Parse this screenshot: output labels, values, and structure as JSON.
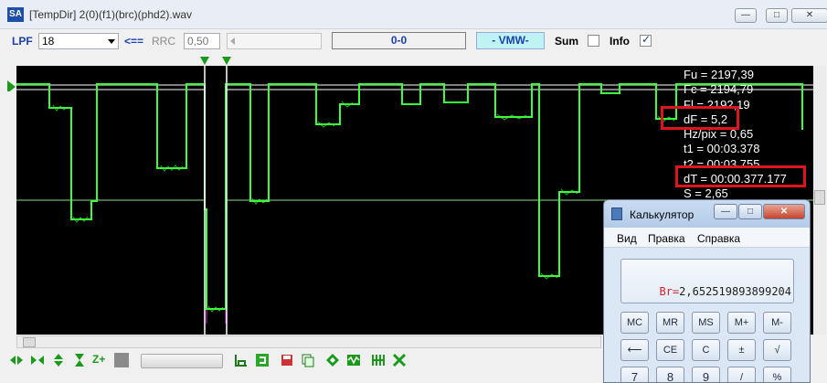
{
  "window": {
    "icon_text": "SA",
    "title": "[TempDir] 2(0)(f1)(brc)(phd2).wav",
    "min_label": "—",
    "max_label": "□",
    "close_label": "✕"
  },
  "toolbar": {
    "lpf_label": "LPF",
    "lpf_value": "18",
    "arrow_label": "<==",
    "rrc_label": "RRC",
    "rrc_value": "0,50",
    "readout": "0-0",
    "mode": "- VMW-",
    "sum_label": "Sum",
    "sum_checked": false,
    "info_label": "Info",
    "info_checked": true
  },
  "plot": {
    "trace_color": "#39ff39",
    "cursor_color": "#ffffff",
    "marker_color": "#1a9a1a",
    "highlight_color": "#cc22cc",
    "info": {
      "fu": "Fu = 2197,39",
      "fc": "Fc = 2194,79",
      "fl": "Fl = 2192,19",
      "df": "dF = 5,2",
      "hzpix": "Hz/pix = 0,65",
      "t1": "t1 = 00:03.378",
      "t2": "t2 = 00:03.755",
      "dt": "dT = 00:00.377.177",
      "s": "S = 2,65"
    }
  },
  "bottom_toolbar": {
    "icons": [
      "left-right-arrows-icon",
      "shrink-arrows-icon",
      "up-down-arrows-icon",
      "hourglass-icon",
      "zoom-plus-icon",
      "stop-icon",
      "spectrum-icon",
      "refresh-icon",
      "save-icon",
      "copy-icon",
      "diamond-icon",
      "wave-icon",
      "bars-icon",
      "cross-icon"
    ],
    "zoom_label": "Z+"
  },
  "calculator": {
    "title": "Калькулятор",
    "menu": [
      "Вид",
      "Правка",
      "Справка"
    ],
    "display_prefix": "Br=",
    "display_value": "2,652519893899204",
    "keys_row1": [
      "MC",
      "MR",
      "MS",
      "M+",
      "M-"
    ],
    "keys_row2": [
      "⟵",
      "CE",
      "C",
      "±",
      "√"
    ],
    "keys_row3": [
      "7",
      "8",
      "9",
      "/",
      "%"
    ]
  }
}
